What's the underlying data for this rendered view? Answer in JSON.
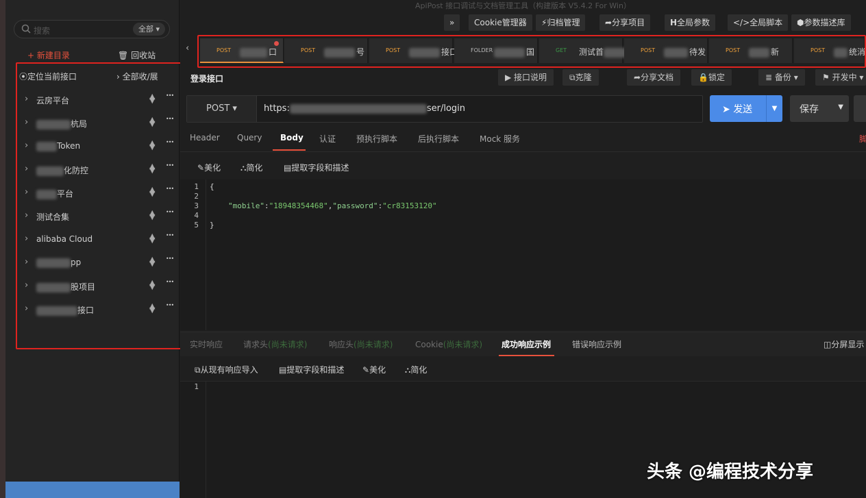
{
  "window": {
    "title": "ApiPost 接口调试与文档管理工具（构建版本 V5.4.2 For Win）"
  },
  "toolbar": {
    "collapse": "»",
    "cookie": "Cookie管理器",
    "archive": "归档管理",
    "share_project": "分享项目",
    "global_params": "全局参数",
    "global_script": "全局脚本",
    "param_desc": "参数描述库"
  },
  "sidebar": {
    "search_placeholder": "搜索",
    "search_scope": "全部",
    "new_dir": "+ 新建目录",
    "recycle": "回收站",
    "locate": "定位当前接口",
    "expand_all": "全部收/展",
    "items": [
      {
        "label": "云房平台"
      },
      {
        "label": "杭局"
      },
      {
        "label": "Token"
      },
      {
        "label": "化防控"
      },
      {
        "label": "平台"
      },
      {
        "label": "测试合集"
      },
      {
        "label": "alibaba Cloud"
      },
      {
        "label": "pp"
      },
      {
        "label": "股项目"
      },
      {
        "label": "接口"
      }
    ]
  },
  "tabs": [
    {
      "method": "POST",
      "name": "口"
    },
    {
      "method": "POST",
      "name": "号"
    },
    {
      "method": "POST",
      "name": "接口"
    },
    {
      "method": "FOLDER",
      "name": "国"
    },
    {
      "method": "GET",
      "name": "测试首"
    },
    {
      "method": "POST",
      "name": "待发"
    },
    {
      "method": "POST",
      "name": "新"
    },
    {
      "method": "POST",
      "name": "统消"
    }
  ],
  "request": {
    "title": "登录接口",
    "actions": {
      "doc": "接口说明",
      "clone": "克隆",
      "share_doc": "分享文档",
      "lock": "锁定",
      "backup": "备份",
      "status": "开发中"
    },
    "method": "POST",
    "url_start": "https:",
    "url_end": "ser/login",
    "send": "发送",
    "save": "保存",
    "tabs": [
      "Header",
      "Query",
      "Body",
      "认证",
      "预执行脚本",
      "后执行脚本",
      "Mock 服务"
    ],
    "right_hint": "脚",
    "body_tools": {
      "beautify": "美化",
      "simplify": "简化",
      "extract": "提取字段和描述"
    },
    "code": {
      "lines": [
        "1",
        "2",
        "3",
        "4",
        "5"
      ],
      "open": "{",
      "mobile_key": "\"mobile\"",
      "mobile_val": "\"18948354468\"",
      "password_key": "\"password\"",
      "password_val": "\"cr83153120\"",
      "close": "}"
    }
  },
  "response": {
    "tabs": [
      "实时响应",
      "请求头",
      "响应头",
      "Cookie",
      "成功响应示例",
      "错误响应示例"
    ],
    "not_requested": "(尚未请求)",
    "split": "分屏显示",
    "tools": {
      "import": "从现有响应导入",
      "extract": "提取字段和描述",
      "beautify": "美化",
      "simplify": "简化"
    },
    "line": "1"
  },
  "watermark": "头条 @编程技术分享"
}
